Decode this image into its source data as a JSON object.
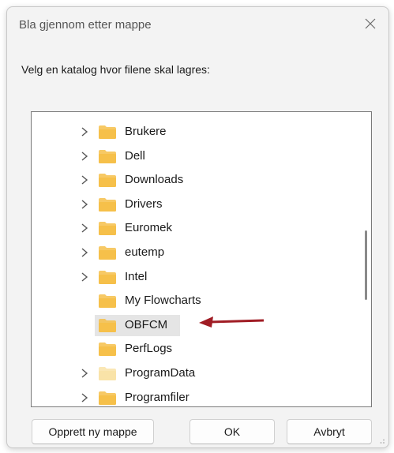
{
  "dialog": {
    "title": "Bla gjennom etter mappe",
    "instruction": "Velg en katalog hvor filene skal lagres:"
  },
  "tree": {
    "items": [
      {
        "label": "Brukere",
        "expandable": true,
        "selected": false
      },
      {
        "label": "Dell",
        "expandable": true,
        "selected": false
      },
      {
        "label": "Downloads",
        "expandable": true,
        "selected": false
      },
      {
        "label": "Drivers",
        "expandable": true,
        "selected": false
      },
      {
        "label": "Euromek",
        "expandable": true,
        "selected": false
      },
      {
        "label": "eutemp",
        "expandable": true,
        "selected": false
      },
      {
        "label": "Intel",
        "expandable": true,
        "selected": false
      },
      {
        "label": "My Flowcharts",
        "expandable": false,
        "selected": false
      },
      {
        "label": "OBFCM",
        "expandable": false,
        "selected": true
      },
      {
        "label": "PerfLogs",
        "expandable": false,
        "selected": false
      },
      {
        "label": "ProgramData",
        "expandable": true,
        "selected": false,
        "hidden_folder": true
      },
      {
        "label": "Programfiler",
        "expandable": true,
        "selected": false
      }
    ]
  },
  "buttons": {
    "new_folder": "Opprett ny mappe",
    "ok": "OK",
    "cancel": "Avbryt"
  },
  "colors": {
    "folder": "#f6c04a",
    "folder_hidden": "#f9e3a8",
    "selection": "#e5e5e5",
    "annotation_arrow": "#a01c24"
  }
}
